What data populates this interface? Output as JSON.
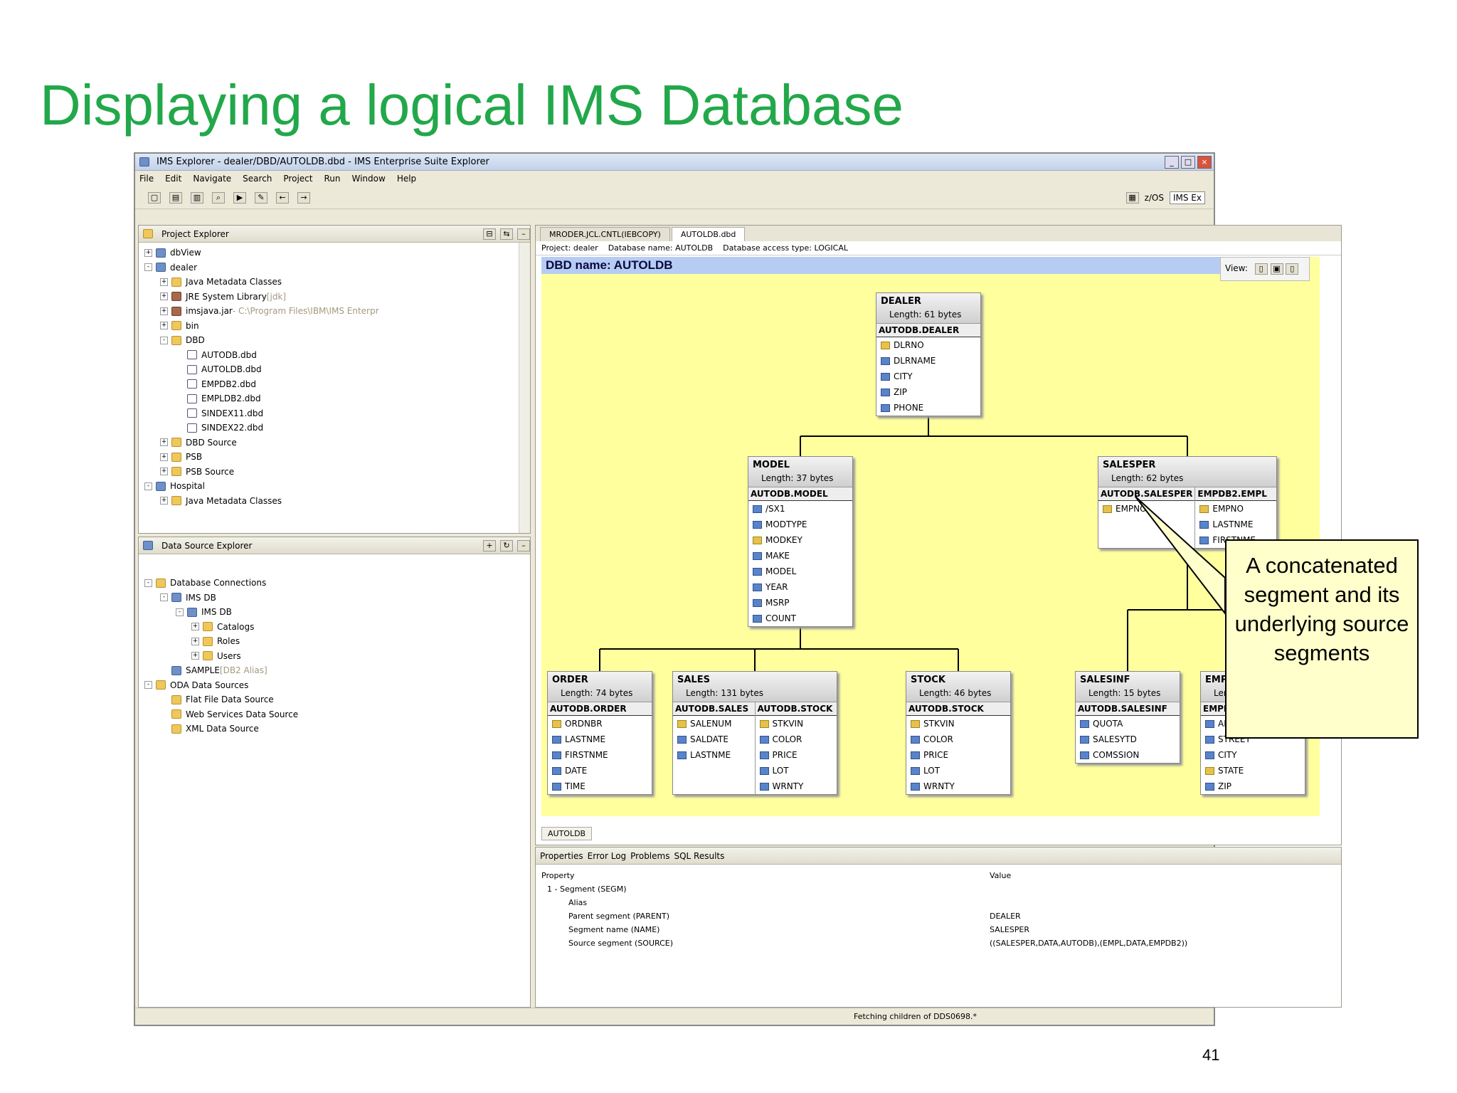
{
  "slide": {
    "title": "Displaying a logical IMS Database",
    "page_number": "41",
    "callout": "A concatenated segment and its underlying source segments"
  },
  "window": {
    "title": "IMS Explorer - dealer/DBD/AUTOLDB.dbd - IMS Enterprise Suite Explorer",
    "menu": [
      "File",
      "Edit",
      "Navigate",
      "Search",
      "Project",
      "Run",
      "Window",
      "Help"
    ],
    "perspectives": [
      "z/OS",
      "IMS Ex"
    ]
  },
  "project_explorer": {
    "title": "Project Explorer",
    "items": [
      {
        "label": "dbView",
        "depth": 0,
        "exp": "+",
        "icon": "db"
      },
      {
        "label": "dealer",
        "depth": 0,
        "exp": "-",
        "icon": "db"
      },
      {
        "label": "Java Metadata Classes",
        "depth": 1,
        "exp": "+",
        "icon": "folder"
      },
      {
        "label": "JRE System Library",
        "suffix": " [jdk]",
        "depth": 1,
        "exp": "+",
        "icon": "jar"
      },
      {
        "label": "imsjava.jar",
        "suffix": " - C:\\Program Files\\IBM\\IMS Enterpr",
        "depth": 1,
        "exp": "+",
        "icon": "jar"
      },
      {
        "label": "bin",
        "depth": 1,
        "exp": "+",
        "icon": "folder"
      },
      {
        "label": "DBD",
        "depth": 1,
        "exp": "-",
        "icon": "folder"
      },
      {
        "label": "AUTODB.dbd",
        "depth": 2,
        "exp": "",
        "icon": "file"
      },
      {
        "label": "AUTOLDB.dbd",
        "depth": 2,
        "exp": "",
        "icon": "file"
      },
      {
        "label": "EMPDB2.dbd",
        "depth": 2,
        "exp": "",
        "icon": "file"
      },
      {
        "label": "EMPLDB2.dbd",
        "depth": 2,
        "exp": "",
        "icon": "file"
      },
      {
        "label": "SINDEX11.dbd",
        "depth": 2,
        "exp": "",
        "icon": "file"
      },
      {
        "label": "SINDEX22.dbd",
        "depth": 2,
        "exp": "",
        "icon": "file"
      },
      {
        "label": "DBD Source",
        "depth": 1,
        "exp": "+",
        "icon": "folder"
      },
      {
        "label": "PSB",
        "depth": 1,
        "exp": "+",
        "icon": "folder"
      },
      {
        "label": "PSB Source",
        "depth": 1,
        "exp": "+",
        "icon": "folder"
      },
      {
        "label": "Hospital",
        "depth": 0,
        "exp": "-",
        "icon": "db"
      },
      {
        "label": "Java Metadata Classes",
        "depth": 1,
        "exp": "+",
        "icon": "folder"
      }
    ]
  },
  "data_source_explorer": {
    "title": "Data Source Explorer",
    "items": [
      {
        "label": "Database Connections",
        "depth": 0,
        "exp": "-",
        "icon": "folder"
      },
      {
        "label": "IMS DB",
        "depth": 1,
        "exp": "-",
        "icon": "db"
      },
      {
        "label": "IMS DB",
        "depth": 2,
        "exp": "-",
        "icon": "db"
      },
      {
        "label": "Catalogs",
        "depth": 3,
        "exp": "+",
        "icon": "folder"
      },
      {
        "label": "Roles",
        "depth": 3,
        "exp": "+",
        "icon": "folder"
      },
      {
        "label": "Users",
        "depth": 3,
        "exp": "+",
        "icon": "folder"
      },
      {
        "label": "SAMPLE",
        "suffix": " [DB2 Alias]",
        "depth": 1,
        "exp": "",
        "icon": "db"
      },
      {
        "label": "ODA Data Sources",
        "depth": 0,
        "exp": "-",
        "icon": "folder"
      },
      {
        "label": "Flat File Data Source",
        "depth": 1,
        "exp": "",
        "icon": "folder"
      },
      {
        "label": "Web Services Data Source",
        "depth": 1,
        "exp": "",
        "icon": "folder"
      },
      {
        "label": "XML Data Source",
        "depth": 1,
        "exp": "",
        "icon": "folder"
      }
    ]
  },
  "editor": {
    "tabs": [
      "MRODER.JCL.CNTL(IEBCOPY)",
      "AUTOLDB.dbd"
    ],
    "info": [
      "Project: dealer",
      "Database name: AUTOLDB",
      "Database access type: LOGICAL"
    ],
    "dbd_name": "DBD name: AUTOLDB",
    "view_label": "View:",
    "bottom_tab": "AUTOLDB"
  },
  "segments": {
    "dealer": {
      "name": "DEALER",
      "length": "Length: 61 bytes",
      "cols": [
        {
          "title": "AUTODB.DEALER",
          "fields": [
            {
              "n": "DLRNO",
              "k": true
            },
            {
              "n": "DLRNAME",
              "k": false
            },
            {
              "n": "CITY",
              "k": false
            },
            {
              "n": "ZIP",
              "k": false
            },
            {
              "n": "PHONE",
              "k": false
            }
          ]
        }
      ]
    },
    "model": {
      "name": "MODEL",
      "length": "Length: 37 bytes",
      "cols": [
        {
          "title": "AUTODB.MODEL",
          "fields": [
            {
              "n": "/SX1",
              "k": false
            },
            {
              "n": "MODTYPE",
              "k": false
            },
            {
              "n": "MODKEY",
              "k": true
            },
            {
              "n": "MAKE",
              "k": false
            },
            {
              "n": "MODEL",
              "k": false
            },
            {
              "n": "YEAR",
              "k": false
            },
            {
              "n": "MSRP",
              "k": false
            },
            {
              "n": "COUNT",
              "k": false
            }
          ]
        }
      ]
    },
    "salesper": {
      "name": "SALESPER",
      "length": "Length: 62 bytes",
      "cols": [
        {
          "title": "AUTODB.SALESPER",
          "fields": [
            {
              "n": "EMPNO",
              "k": true
            }
          ]
        },
        {
          "title": "EMPDB2.EMPL",
          "fields": [
            {
              "n": "EMPNO",
              "k": true
            },
            {
              "n": "LASTNME",
              "k": false
            },
            {
              "n": "FIRSTNME",
              "k": false
            }
          ]
        }
      ]
    },
    "order": {
      "name": "ORDER",
      "length": "Length: 74 bytes",
      "cols": [
        {
          "title": "AUTODB.ORDER",
          "fields": [
            {
              "n": "ORDNBR",
              "k": true
            },
            {
              "n": "LASTNME",
              "k": false
            },
            {
              "n": "FIRSTNME",
              "k": false
            },
            {
              "n": "DATE",
              "k": false
            },
            {
              "n": "TIME",
              "k": false
            }
          ]
        }
      ]
    },
    "sales": {
      "name": "SALES",
      "length": "Length: 131 bytes",
      "cols": [
        {
          "title": "AUTODB.SALES",
          "fields": [
            {
              "n": "SALENUM",
              "k": true
            },
            {
              "n": "SALDATE",
              "k": false
            },
            {
              "n": "LASTNME",
              "k": false
            }
          ]
        },
        {
          "title": "AUTODB.STOCK",
          "fields": [
            {
              "n": "STKVIN",
              "k": true
            },
            {
              "n": "COLOR",
              "k": false
            },
            {
              "n": "PRICE",
              "k": false
            },
            {
              "n": "LOT",
              "k": false
            },
            {
              "n": "WRNTY",
              "k": false
            }
          ]
        }
      ]
    },
    "stock": {
      "name": "STOCK",
      "length": "Length: 46 bytes",
      "cols": [
        {
          "title": "AUTODB.STOCK",
          "fields": [
            {
              "n": "STKVIN",
              "k": true
            },
            {
              "n": "COLOR",
              "k": false
            },
            {
              "n": "PRICE",
              "k": false
            },
            {
              "n": "LOT",
              "k": false
            },
            {
              "n": "WRNTY",
              "k": false
            }
          ]
        }
      ]
    },
    "salesinf": {
      "name": "SALESINF",
      "length": "Length: 15 bytes",
      "cols": [
        {
          "title": "AUTODB.SALESINF",
          "fields": [
            {
              "n": "QUOTA",
              "k": false
            },
            {
              "n": "SALESYTD",
              "k": false
            },
            {
              "n": "COMSSION",
              "k": false
            }
          ]
        }
      ]
    },
    "emplinfo": {
      "name": "EMPLINFO",
      "length": "Length: 61 bytes",
      "cols": [
        {
          "title": "EMPDB2.EMPLINFO",
          "fields": [
            {
              "n": "ADDRESS",
              "k": false
            },
            {
              "n": "STREET",
              "k": false
            },
            {
              "n": "CITY",
              "k": false
            },
            {
              "n": "STATE",
              "k": true
            },
            {
              "n": "ZIP",
              "k": false
            }
          ]
        }
      ]
    }
  },
  "properties": {
    "tabs": [
      "Properties",
      "Error Log",
      "Problems",
      "SQL Results"
    ],
    "col_property": "Property",
    "col_value": "Value",
    "rows": [
      {
        "k": "1 - Segment (SEGM)",
        "v": ""
      },
      {
        "k": "Alias",
        "v": ""
      },
      {
        "k": "Parent segment (PARENT)",
        "v": "DEALER"
      },
      {
        "k": "Segment name (NAME)",
        "v": "SALESPER"
      },
      {
        "k": "Source segment (SOURCE)",
        "v": "((SALESPER,DATA,AUTODB),(EMPL,DATA,EMPDB2))"
      }
    ]
  },
  "status": {
    "text": "Fetching children of DDS0698.*"
  },
  "colors": {
    "title_green": "#22a84a",
    "canvas_yellow": "#ffff9e",
    "callout_bg": "#ffffcc"
  }
}
